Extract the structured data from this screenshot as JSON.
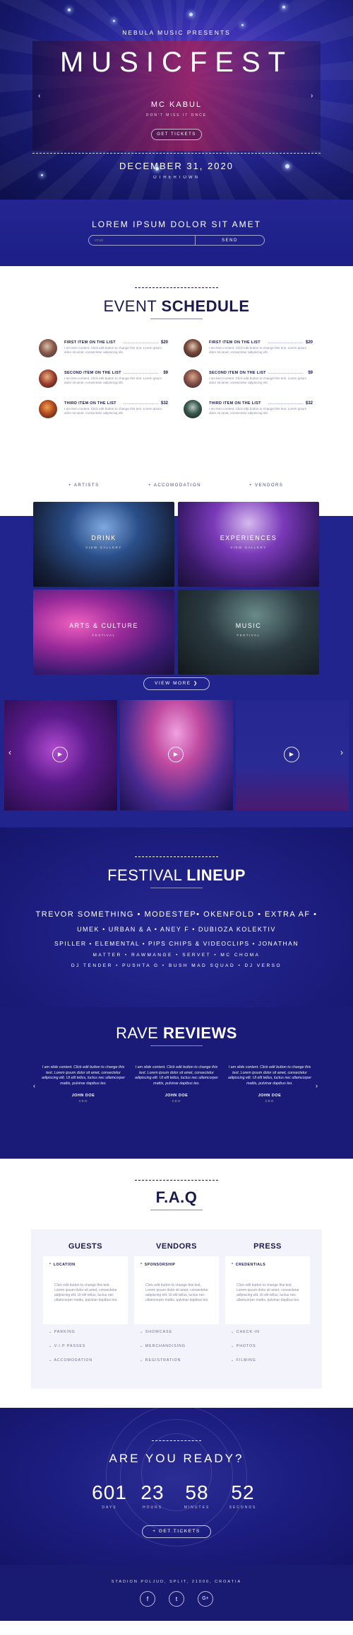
{
  "hero": {
    "presents": "NEBULA MUSIC PRESENTS",
    "title": "MUSICFEST",
    "artist": "MC KABUL",
    "tagline": "DON'T MISS IT ONCE",
    "ticket_button": "GET TICKETS",
    "date": "DECEMBER 31, 2020",
    "place": "OTHERTOWN",
    "prev_arrow": "‹",
    "next_arrow": "›"
  },
  "newsletter": {
    "heading": "LOREM IPSUM DOLOR SIT AMET",
    "placeholder": "email",
    "button": "SEND"
  },
  "schedule": {
    "title_light": "EVENT",
    "title_bold": "SCHEDULE",
    "items": [
      {
        "name": "FIRST ITEM ON THE LIST",
        "price": "$20",
        "desc": "I am item content. Click edit button to change this text. Lorem ipsum dolor sit amet, consectetur adipiscing elit."
      },
      {
        "name": "FIRST ITEM ON THE LIST",
        "price": "$20",
        "desc": "I am item content. Click edit button to change this text. Lorem ipsum dolor sit amet, consectetur adipiscing elit."
      },
      {
        "name": "SECOND ITEM ON THE LIST",
        "price": "$9",
        "desc": "I am item content. Click edit button to change this text. Lorem ipsum dolor sit amet, consectetur adipiscing elit."
      },
      {
        "name": "SECOND ITEM ON THE LIST",
        "price": "$9",
        "desc": "I am item content. Click edit button to change this text. Lorem ipsum dolor sit amet, consectetur adipiscing elit."
      },
      {
        "name": "THIRD ITEM ON THE LIST",
        "price": "$32",
        "desc": "I am item content. Click edit button to change this text. Lorem ipsum dolor sit amet, consectetur adipiscing elit."
      },
      {
        "name": "THIRD ITEM ON THE LIST",
        "price": "$32",
        "desc": "I am item content. Click edit button to change this text. Lorem ipsum dolor sit amet, consectetur adipiscing elit."
      }
    ],
    "tabs": [
      "+ ARTISTS",
      "+ ACCOMODATION",
      "+ VENDORS"
    ]
  },
  "gallery": {
    "tiles": [
      {
        "label": "DRINK",
        "sub": "VIEW GALLERY"
      },
      {
        "label": "EXPERIENCES",
        "sub": "VIEW GALLERY"
      },
      {
        "label": "ARTS & CULTURE",
        "sub": "FESTIVAL"
      },
      {
        "label": "MUSIC",
        "sub": "FESTIVAL"
      }
    ],
    "view_more": "VIEW MORE ❯",
    "play": "▶",
    "prev_arrow": "‹",
    "next_arrow": "›"
  },
  "lineup": {
    "title_light": "FESTIVAL",
    "title_bold": "LINEUP",
    "rows": [
      "TREVOR SOMETHING • MODESTEP• OKENFOLD • EXTRA AF •",
      "UMEK • URBAN & A • ANEY F • DUBIOZA KOLEKTIV",
      "SPILLER • ELEMENTAL • PIPS CHIPS & VIDEOCLIPS • JONATHAN",
      "MATTER • RAWMANGE • SERVET • MC CHOMA",
      "DJ TENDER • PUSHTA G • BUSH MAD SQUAD • DJ VERSO"
    ]
  },
  "reviews": {
    "title_light": "RAVE",
    "title_bold": "REVIEWS",
    "items": [
      {
        "text": "I am slide content. Click edit button to change this text. Lorem ipsum dolor sit amet, consectetur adipiscing elit. Ut elit tellus, luctus nec ullamcorper mattis, pulvinar dapibus leo.",
        "author": "JOHN DOE",
        "role": "CEO"
      },
      {
        "text": "I am slide content. Click edit button to change this text. Lorem ipsum dolor sit amet, consectetur adipiscing elit. Ut elit tellus, luctus nec ullamcorper mattis, pulvinar dapibus leo.",
        "author": "JOHN DOE",
        "role": "CEO"
      },
      {
        "text": "I am slide content. Click edit button to change this text. Lorem ipsum dolor sit amet, consectetur adipiscing elit. Ut elit tellus, luctus nec ullamcorper mattis, pulvinar dapibus leo.",
        "author": "JOHN DOE",
        "role": "CEO"
      }
    ],
    "prev_arrow": "‹",
    "next_arrow": "›"
  },
  "faq": {
    "title": "F.A.Q",
    "columns": [
      {
        "head": "GUESTS",
        "open_q": "LOCATION",
        "answer": "Click edit button to change this text. Lorem ipsum dolor sit amet, consectetur adipiscing elit. Ut elit tellus, luctus nec ullamcorper mattis, pulvinar dapibus leo.",
        "items": [
          "PARKING",
          "V.I.P PASSES",
          "ACCOMODATION"
        ]
      },
      {
        "head": "VENDORS",
        "open_q": "SPONSORSHIP",
        "answer": "Click edit button to change this text. Lorem ipsum dolor sit amet, consectetur adipiscing elit. Ut elit tellus, luctus nec ullamcorper mattis, pulvinar dapibus leo.",
        "items": [
          "SHOWCASE",
          "MERCHANDISING",
          "REGISTRATION"
        ]
      },
      {
        "head": "PRESS",
        "open_q": "CREDENTIALS",
        "answer": "Click edit button to change this text. Lorem ipsum dolor sit amet, consectetur adipiscing elit. Ut elit tellus, luctus nec ullamcorper mattis, pulvinar dapibus leo.",
        "items": [
          "CHECK-IN",
          "PHOTOS",
          "FILMING"
        ]
      }
    ]
  },
  "countdown": {
    "title": "ARE YOU READY?",
    "units": [
      {
        "value": "601",
        "label": "DAYS"
      },
      {
        "value": "23",
        "label": "HOURS"
      },
      {
        "value": "58",
        "label": "MINUTES"
      },
      {
        "value": "52",
        "label": "SECONDS"
      }
    ],
    "cta": "+ GET TICKETS"
  },
  "footer": {
    "address": "STADION POLJUD, SPLIT, 21000, CROATIA",
    "social": [
      "f",
      "t",
      "G+"
    ]
  },
  "colors": {
    "navy": "#1a1a4e",
    "royal_blue": "#22248e",
    "accent_magenta": "#c2185b"
  }
}
